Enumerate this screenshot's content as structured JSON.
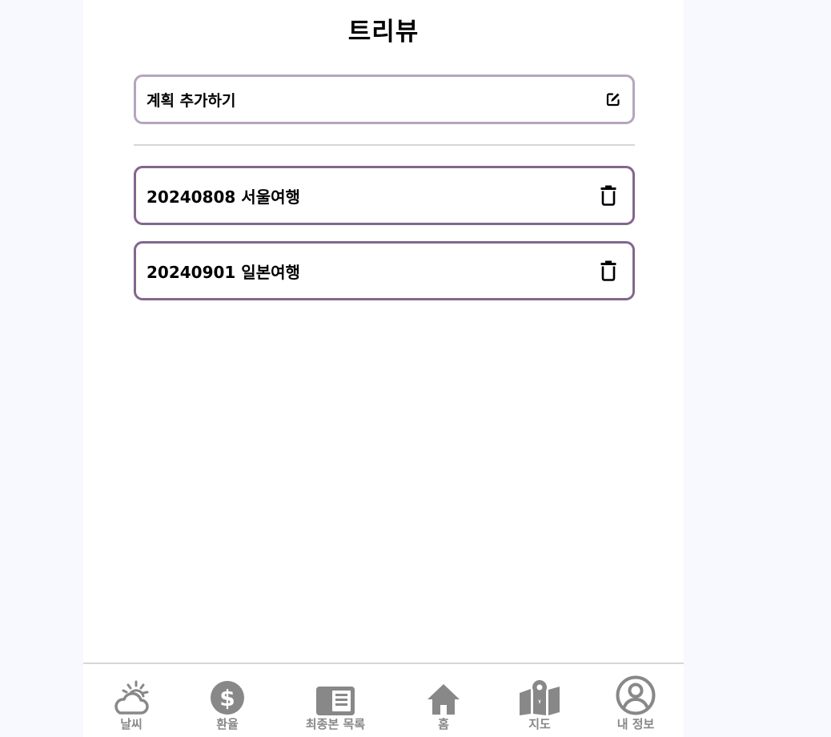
{
  "header": {
    "title": "트리뷰"
  },
  "add_plan": {
    "label": "계획 추가하기",
    "icon": "edit-icon"
  },
  "plans": [
    {
      "label": "20240808 서울여행",
      "icon": "trash-icon"
    },
    {
      "label": "20240901 일본여행",
      "icon": "trash-icon"
    }
  ],
  "nav": {
    "items": [
      {
        "label": "날씨",
        "icon": "weather-icon"
      },
      {
        "label": "환율",
        "icon": "dollar-icon"
      },
      {
        "label": "최종본 목록",
        "icon": "list-book-icon"
      },
      {
        "label": "홈",
        "icon": "home-icon"
      },
      {
        "label": "지도",
        "icon": "map-icon"
      },
      {
        "label": "내 정보",
        "icon": "profile-icon"
      }
    ]
  },
  "colors": {
    "add_border": "#b6a5bd",
    "plan_border": "#82678e",
    "nav_icon": "#888888",
    "background": "#f8f9ff"
  }
}
